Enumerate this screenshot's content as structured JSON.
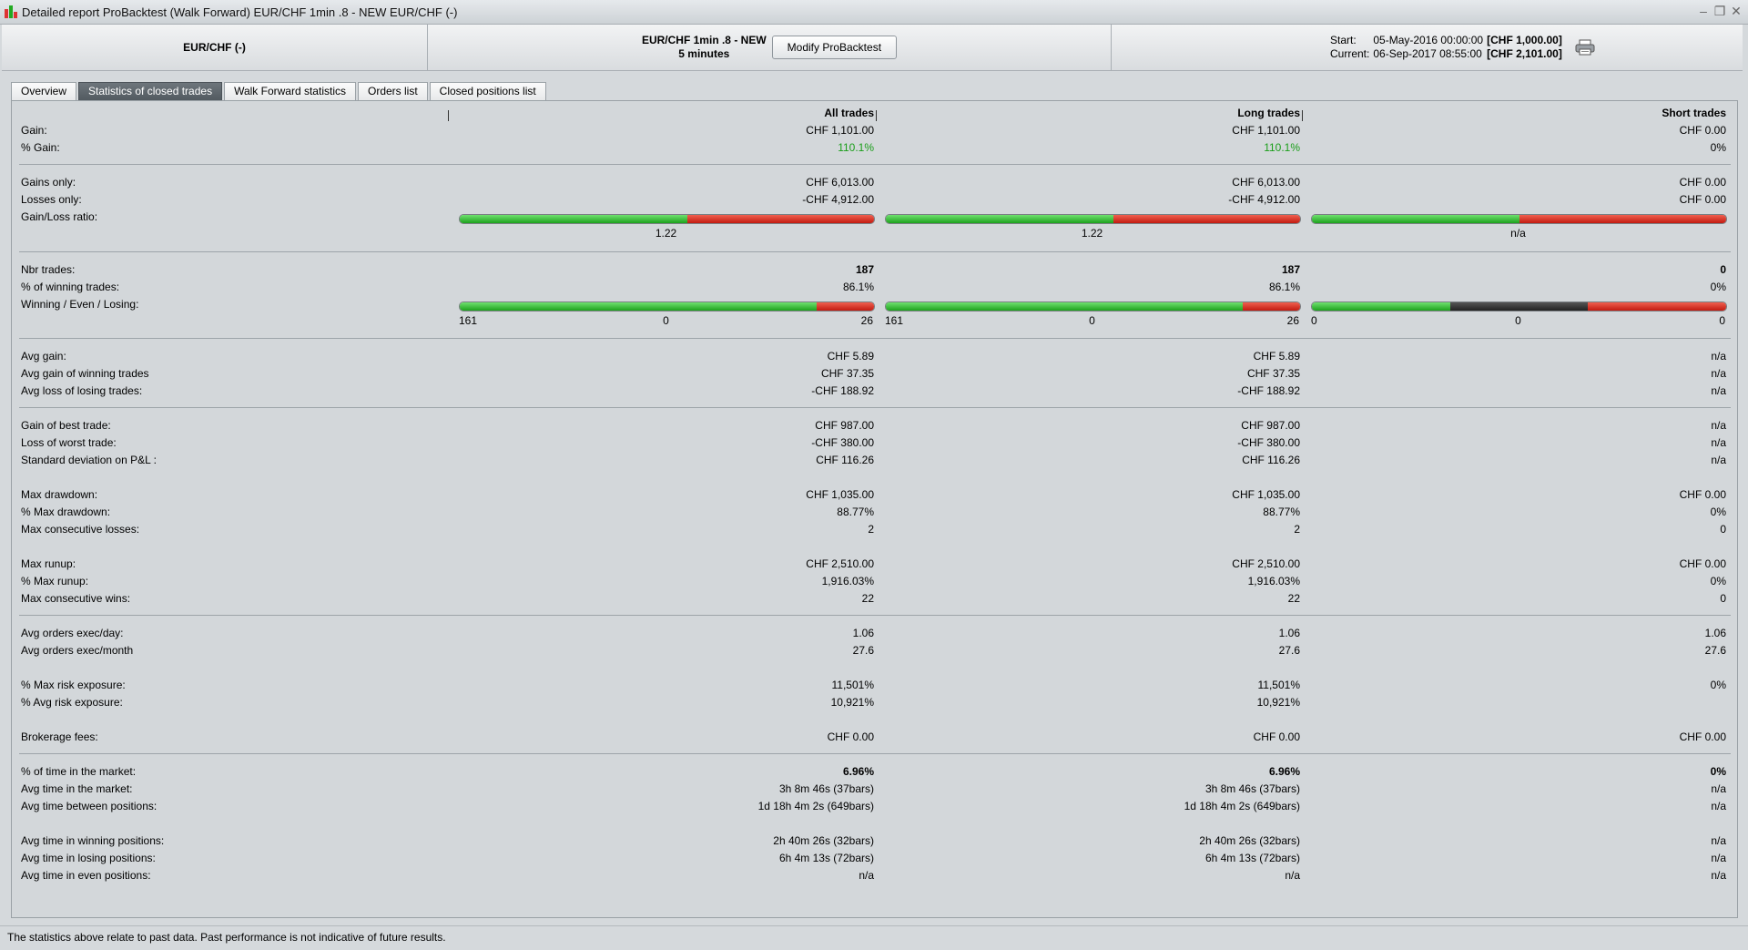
{
  "window": {
    "title": "Detailed report  ProBacktest (Walk Forward)  EUR/CHF 1min .8 - NEW  EUR/CHF (-)",
    "controls": {
      "minimize": "–",
      "restore": "❐",
      "close": "✕"
    }
  },
  "header": {
    "instrument": "EUR/CHF (-)",
    "strategy_name": "EUR/CHF 1min .8 - NEW",
    "timeframe": "5 minutes",
    "modify_button": "Modify ProBacktest",
    "start_label": "Start:",
    "start_date": "05-May-2016 00:00:00",
    "start_capital": "[CHF 1,000.00]",
    "current_label": "Current:",
    "current_date": "06-Sep-2017 08:55:00",
    "current_capital": "[CHF 2,101.00]",
    "print_icon": "printer-icon"
  },
  "tabs": [
    "Overview",
    "Statistics of closed trades",
    "Walk Forward statistics",
    "Orders list",
    "Closed positions list"
  ],
  "active_tab": 1,
  "columns": [
    "All trades",
    "Long trades",
    "Short trades"
  ],
  "rows": {
    "gain": {
      "label": "Gain:",
      "v": [
        "CHF 1,101.00",
        "CHF 1,101.00",
        "CHF 0.00"
      ]
    },
    "pct_gain": {
      "label": "% Gain:",
      "v": [
        "110.1%",
        "110.1%",
        "0%"
      ]
    },
    "gains_only": {
      "label": "Gains only:",
      "v": [
        "CHF 6,013.00",
        "CHF 6,013.00",
        "CHF 0.00"
      ]
    },
    "losses_only": {
      "label": "Losses only:",
      "v": [
        "-CHF 4,912.00",
        "-CHF 4,912.00",
        "CHF 0.00"
      ]
    },
    "gain_loss_ratio": {
      "label": "Gain/Loss ratio:",
      "v": [
        "1.22",
        "1.22",
        "n/a"
      ]
    },
    "nbr_trades": {
      "label": "Nbr trades:",
      "v": [
        "187",
        "187",
        "0"
      ]
    },
    "pct_winning": {
      "label": "% of winning trades:",
      "v": [
        "86.1%",
        "86.1%",
        "0%"
      ]
    },
    "wel": {
      "label": "Winning / Even / Losing:",
      "win": [
        "161",
        "161",
        "0"
      ],
      "even": [
        "0",
        "0",
        "0"
      ],
      "lose": [
        "26",
        "26",
        "0"
      ]
    },
    "avg_gain": {
      "label": "Avg gain:",
      "v": [
        "CHF 5.89",
        "CHF 5.89",
        "n/a"
      ]
    },
    "avg_gain_win": {
      "label": "Avg gain of winning trades",
      "v": [
        "CHF 37.35",
        "CHF 37.35",
        "n/a"
      ]
    },
    "avg_loss_lose": {
      "label": "Avg loss of losing trades:",
      "v": [
        "-CHF 188.92",
        "-CHF 188.92",
        "n/a"
      ]
    },
    "best_trade": {
      "label": "Gain of best trade:",
      "v": [
        "CHF 987.00",
        "CHF 987.00",
        "n/a"
      ]
    },
    "worst_trade": {
      "label": "Loss of worst trade:",
      "v": [
        "-CHF 380.00",
        "-CHF 380.00",
        "n/a"
      ]
    },
    "std_dev": {
      "label": "Standard deviation on P&L :",
      "v": [
        "CHF 116.26",
        "CHF 116.26",
        "n/a"
      ]
    },
    "max_dd": {
      "label": "Max drawdown:",
      "v": [
        "CHF 1,035.00",
        "CHF 1,035.00",
        "CHF 0.00"
      ]
    },
    "pct_max_dd": {
      "label": "% Max drawdown:",
      "v": [
        "88.77%",
        "88.77%",
        "0%"
      ]
    },
    "max_consec_losses": {
      "label": "Max consecutive losses:",
      "v": [
        "2",
        "2",
        "0"
      ]
    },
    "max_runup": {
      "label": "Max runup:",
      "v": [
        "CHF 2,510.00",
        "CHF 2,510.00",
        "CHF 0.00"
      ]
    },
    "pct_max_runup": {
      "label": "% Max runup:",
      "v": [
        "1,916.03%",
        "1,916.03%",
        "0%"
      ]
    },
    "max_consec_wins": {
      "label": "Max consecutive wins:",
      "v": [
        "22",
        "22",
        "0"
      ]
    },
    "orders_day": {
      "label": "Avg orders exec/day:",
      "v": [
        "1.06",
        "1.06",
        "1.06"
      ]
    },
    "orders_month": {
      "label": "Avg orders exec/month",
      "v": [
        "27.6",
        "27.6",
        "27.6"
      ]
    },
    "max_risk": {
      "label": "% Max risk exposure:",
      "v": [
        "11,501%",
        "11,501%",
        "0%"
      ]
    },
    "avg_risk": {
      "label": "% Avg risk exposure:",
      "v": [
        "10,921%",
        "10,921%",
        ""
      ]
    },
    "fees": {
      "label": "Brokerage fees:",
      "v": [
        "CHF 0.00",
        "CHF 0.00",
        "CHF 0.00"
      ]
    },
    "time_market_pct": {
      "label": "% of time in the market:",
      "v": [
        "6.96%",
        "6.96%",
        "0%"
      ]
    },
    "avg_time_market": {
      "label": "Avg time in the market:",
      "v": [
        "3h 8m 46s (37bars)",
        "3h 8m 46s (37bars)",
        "n/a"
      ]
    },
    "avg_time_between": {
      "label": "Avg time between positions:",
      "v": [
        "1d 18h 4m 2s (649bars)",
        "1d 18h 4m 2s (649bars)",
        "n/a"
      ]
    },
    "avg_time_win": {
      "label": "Avg time in winning positions:",
      "v": [
        "2h 40m 26s (32bars)",
        "2h 40m 26s (32bars)",
        "n/a"
      ]
    },
    "avg_time_lose": {
      "label": "Avg time in losing positions:",
      "v": [
        "6h 4m 13s (72bars)",
        "6h 4m 13s (72bars)",
        "n/a"
      ]
    },
    "avg_time_even": {
      "label": "Avg time in even positions:",
      "v": [
        "n/a",
        "n/a",
        "n/a"
      ]
    }
  },
  "ratio_bars": [
    {
      "gain": 6013,
      "loss": 4912
    },
    {
      "gain": 6013,
      "loss": 4912
    },
    {
      "gain": 0,
      "loss": 0
    }
  ],
  "wel_bars": [
    {
      "win": 161,
      "even": 0,
      "lose": 26
    },
    {
      "win": 161,
      "even": 0,
      "lose": 26
    },
    {
      "win": 0,
      "even": 0,
      "lose": 0
    }
  ],
  "colors": {
    "positive": "#1a9e1a",
    "bar_green": "#1da11d",
    "bar_red": "#c21a10",
    "bar_even": "#222222",
    "active_tab": "#5a6268"
  },
  "footer": "The statistics above relate to past data. Past performance is not indicative of future results."
}
